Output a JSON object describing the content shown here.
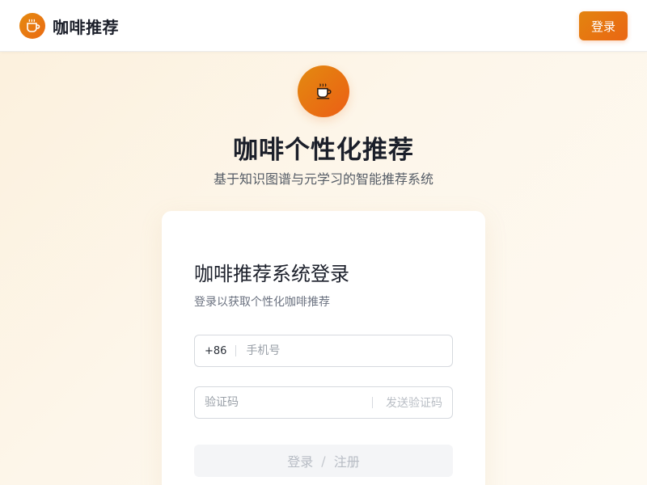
{
  "header": {
    "brand_name": "咖啡推荐",
    "brand_icon": "coffee-cup-icon",
    "login_label": "登录"
  },
  "hero": {
    "icon": "coffee-cup-icon",
    "title": "咖啡个性化推荐",
    "subtitle": "基于知识图谱与元学习的智能推荐系统"
  },
  "login_card": {
    "title": "咖啡推荐系统登录",
    "subtitle": "登录以获取个性化咖啡推荐",
    "phone": {
      "prefix": "+86",
      "placeholder": "手机号",
      "value": ""
    },
    "code": {
      "placeholder": "验证码",
      "value": "",
      "send_label": "发送验证码"
    },
    "submit": {
      "login_label": "登录",
      "separator": "/",
      "register_label": "注册"
    }
  },
  "colors": {
    "accent_start": "#e38410",
    "accent_end": "#ea6612",
    "background": "#fdf6ea"
  }
}
